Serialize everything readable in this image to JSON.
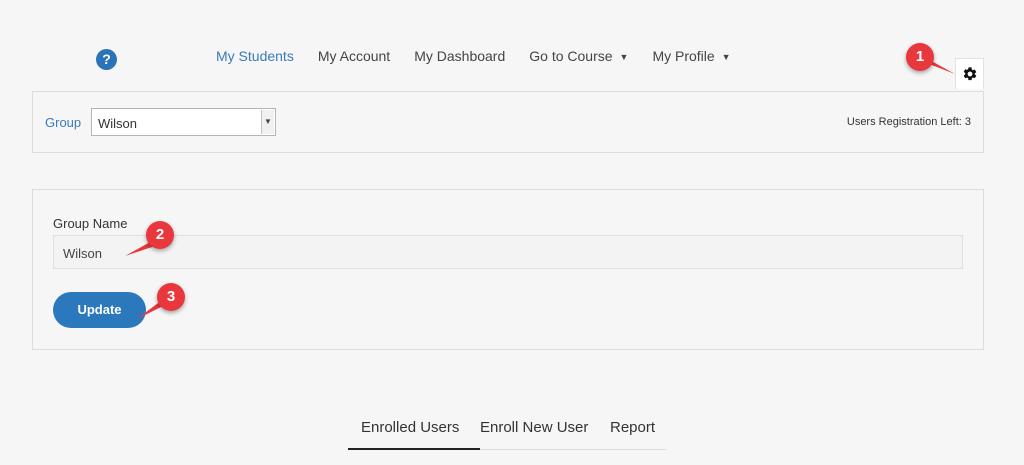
{
  "help": {
    "icon": "question-circle-icon",
    "glyph": "?"
  },
  "nav": {
    "items": [
      {
        "label": "My Students",
        "active": true,
        "dropdown": false
      },
      {
        "label": "My Account",
        "active": false,
        "dropdown": false
      },
      {
        "label": "My Dashboard",
        "active": false,
        "dropdown": false
      },
      {
        "label": "Go to Course",
        "active": false,
        "dropdown": true
      },
      {
        "label": "My Profile",
        "active": false,
        "dropdown": true
      }
    ]
  },
  "settings": {
    "icon": "gear-icon"
  },
  "group_bar": {
    "label": "Group",
    "selected": "Wilson",
    "registration_left": "Users Registration Left: 3"
  },
  "edit_group": {
    "field_label": "Group Name",
    "field_value": "Wilson",
    "update_label": "Update"
  },
  "tabs": [
    {
      "label": "Enrolled Users",
      "active": true
    },
    {
      "label": "Enroll New User",
      "active": false
    },
    {
      "label": "Report",
      "active": false
    }
  ],
  "callouts": [
    "1",
    "2",
    "3"
  ],
  "colors": {
    "accent": "#2c78bd",
    "nav_active": "#3a7ab8",
    "callout": "#e8383d",
    "background": "#f6f6f6"
  }
}
